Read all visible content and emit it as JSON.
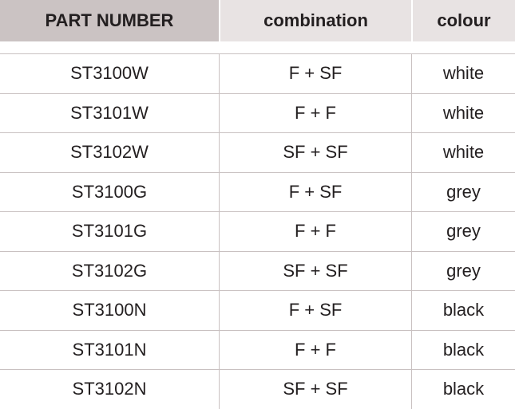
{
  "table": {
    "headers": [
      "PART NUMBER",
      "combination",
      "colour"
    ],
    "rows": [
      {
        "part_number": "ST3100W",
        "combination": "F + SF",
        "colour": "white"
      },
      {
        "part_number": "ST3101W",
        "combination": "F + F",
        "colour": "white"
      },
      {
        "part_number": "ST3102W",
        "combination": "SF + SF",
        "colour": "white"
      },
      {
        "part_number": "ST3100G",
        "combination": "F + SF",
        "colour": "grey"
      },
      {
        "part_number": "ST3101G",
        "combination": "F + F",
        "colour": "grey"
      },
      {
        "part_number": "ST3102G",
        "combination": "SF + SF",
        "colour": "grey"
      },
      {
        "part_number": "ST3100N",
        "combination": "F + SF",
        "colour": "black"
      },
      {
        "part_number": "ST3101N",
        "combination": "F + F",
        "colour": "black"
      },
      {
        "part_number": "ST3102N",
        "combination": "SF + SF",
        "colour": "black"
      }
    ]
  },
  "colors": {
    "header_primary_bg": "#cbc3c3",
    "header_secondary_bg": "#e8e3e3",
    "border": "#c9c1c1",
    "text": "#231f20"
  }
}
